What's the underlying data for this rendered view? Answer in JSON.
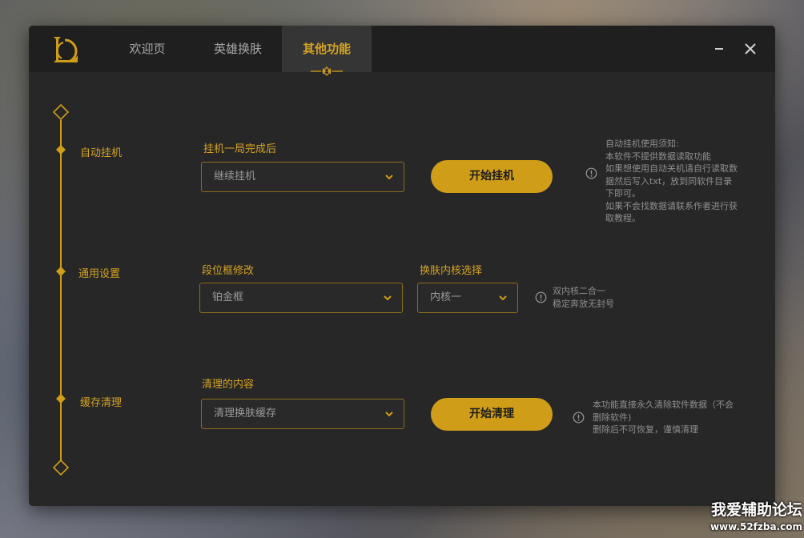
{
  "titlebar": {
    "tabs": [
      {
        "label": "欢迎页",
        "active": false
      },
      {
        "label": "英雄换肤",
        "active": false
      },
      {
        "label": "其他功能",
        "active": true
      }
    ],
    "controls": {
      "minimize_icon": "minimize-icon",
      "close_icon": "close-icon"
    }
  },
  "timeline": {
    "sections": [
      {
        "label": "自动挂机"
      },
      {
        "label": "通用设置"
      },
      {
        "label": "缓存清理"
      }
    ]
  },
  "auto_afk": {
    "field_label": "挂机一局完成后",
    "select_value": "继续挂机",
    "button_label": "开始挂机",
    "note_lines": [
      "自动挂机使用须知:",
      "本软件不提供数据读取功能",
      "如果想使用自动关机请自行读取数",
      "据然后写入txt，放到同软件目录",
      "下即可。",
      "如果不会找数据请联系作者进行获",
      "取教程。"
    ]
  },
  "general": {
    "frame_label": "段位框修改",
    "frame_value": "铂金框",
    "core_label": "换肤内核选择",
    "core_value": "内核一",
    "note_lines": [
      "双内核二合一",
      "稳定奔放无封号"
    ]
  },
  "cache": {
    "field_label": "清理的内容",
    "select_value": "清理换肤缓存",
    "button_label": "开始清理",
    "note_lines": [
      "本功能直接永久清除软件数据（不会",
      "删除软件)",
      "删除后不可恢复，谨慎清理"
    ]
  },
  "watermark": {
    "line1": "我爱辅助论坛",
    "line2": "www.52fzba.com"
  },
  "colors": {
    "accent": "#d5a323",
    "button": "#cf9d17",
    "window_bg": "#272727",
    "titlebar_bg": "#1f1f1f"
  }
}
